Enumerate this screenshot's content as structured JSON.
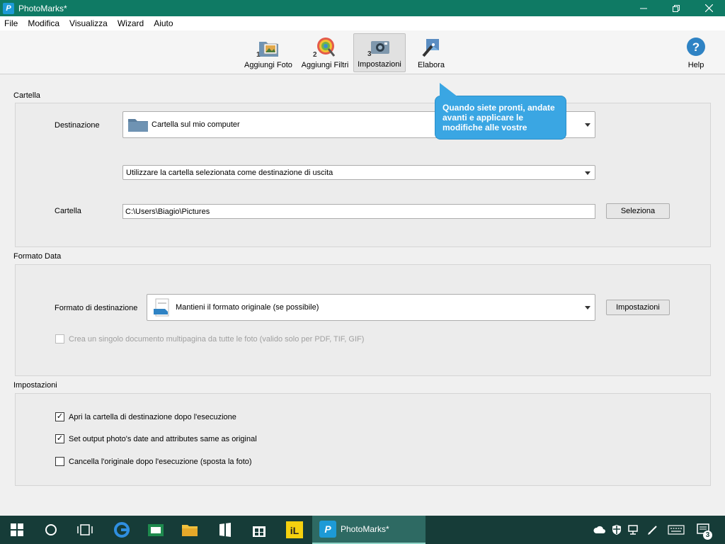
{
  "window": {
    "title": "PhotoMarks*"
  },
  "menu": [
    "File",
    "Modifica",
    "Visualizza",
    "Wizard",
    "Aiuto"
  ],
  "toolbar": {
    "steps": [
      {
        "label": "Aggiungi Foto",
        "num": "1"
      },
      {
        "label": "Aggiungi Filtri",
        "num": "2"
      },
      {
        "label": "Impostazioni",
        "num": "3"
      },
      {
        "label": "Elabora",
        "num": ""
      }
    ],
    "help_label": "Help"
  },
  "tooltip": {
    "text": "Quando siete pronti, andate avanti e applicare le modifiche alle vostre"
  },
  "cartella": {
    "section_label": "Cartella",
    "destination_label": "Destinazione",
    "destination_value": "Cartella sul mio computer",
    "usage_value": "Utilizzare la cartella selezionata come destinazione di uscita",
    "folder_label": "Cartella",
    "folder_path": "C:\\Users\\Biagio\\Pictures",
    "select_button": "Seleziona"
  },
  "formato": {
    "section_label": "Formato Data",
    "format_label": "Formato di destinazione",
    "format_value": "Mantieni il formato originale (se possibile)",
    "settings_button": "Impostazioni",
    "multipage_label": "Crea un singolo documento multipagina da tutte le foto (valido solo per PDF, TIF, GIF)",
    "multipage_checked": false
  },
  "impostazioni": {
    "section_label": "Impostazioni",
    "options": [
      {
        "label": "Apri la cartella di destinazione dopo l'esecuzione",
        "checked": true
      },
      {
        "label": "Set output photo's date and attributes same as original",
        "checked": true
      },
      {
        "label": "Cancella l'originale dopo l'esecuzione (sposta la foto)",
        "checked": false
      }
    ]
  },
  "taskbar": {
    "active_app": "PhotoMarks*",
    "notification_count": "3"
  },
  "colors": {
    "titlebar": "#0f7a64",
    "balloon": "#3aa6e3",
    "taskbar": "#163c38"
  }
}
